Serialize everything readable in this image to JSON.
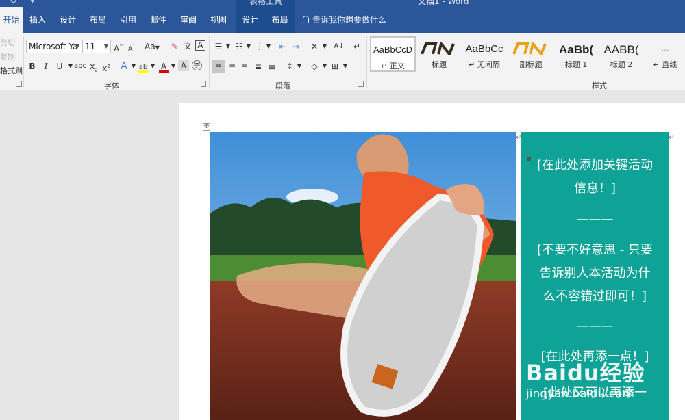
{
  "titlebar": {
    "context_group": "表格工具",
    "document_title": "文档1 - Word"
  },
  "tabs": [
    {
      "label": "开始",
      "active": true
    },
    {
      "label": "插入"
    },
    {
      "label": "设计"
    },
    {
      "label": "布局"
    },
    {
      "label": "引用"
    },
    {
      "label": "邮件"
    },
    {
      "label": "审阅"
    },
    {
      "label": "视图"
    },
    {
      "label": "设计",
      "contextual": true
    },
    {
      "label": "布局",
      "contextual": true
    }
  ],
  "tell_me": "告诉我你想要做什么",
  "clipboard": {
    "cut": "剪切",
    "copy": "复制",
    "format_painter": "格式刷"
  },
  "font": {
    "name": "Microsoft Ya",
    "size": "11",
    "group_label": "字体",
    "change_case": "Aa",
    "phonetic_guide": "文"
  },
  "paragraph": {
    "group_label": "段落"
  },
  "styles": {
    "group_label": "样式",
    "items": [
      {
        "sample": "AaBbCcD",
        "name": "正文",
        "mark": "↵"
      },
      {
        "sample": "/∖/\\",
        "name": "标题"
      },
      {
        "sample": "AaBbCc",
        "name": "无间隔",
        "mark": "↵"
      },
      {
        "sample": "/∖/\\",
        "name": "副标题"
      },
      {
        "sample": "AaBb(",
        "name": "标题 1"
      },
      {
        "sample": "AABB(",
        "name": "标题 2"
      },
      {
        "sample": "…",
        "name": "直线",
        "mark": "↵"
      }
    ]
  },
  "document": {
    "panel_lines": [
      "[在此处添加关键活动",
      "信息！]",
      "———",
      "[不要不好意思 - 只要",
      "告诉别人本活动为什",
      "么不容错过即可！]",
      "———",
      "[在此处再添一点！]",
      "[此处又可以再添一"
    ]
  },
  "watermark": {
    "logo": "Baidu经验",
    "url": "jingyan.baidu.com"
  },
  "colors": {
    "ribbon_blue": "#2b579a",
    "panel_teal": "#0fa398",
    "font_color_red": "#e00000",
    "highlight_yellow": "#ffff00"
  }
}
